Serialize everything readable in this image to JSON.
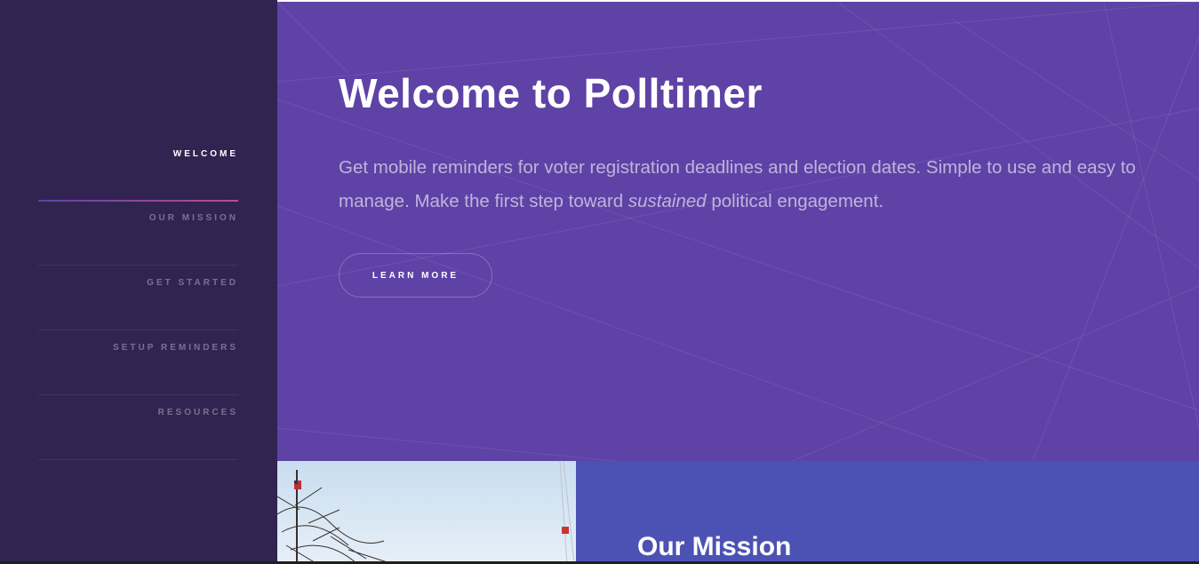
{
  "sidebar": {
    "items": [
      {
        "label": "WELCOME",
        "active": true
      },
      {
        "label": "OUR MISSION",
        "active": false
      },
      {
        "label": "GET STARTED",
        "active": false
      },
      {
        "label": "SETUP REMINDERS",
        "active": false
      },
      {
        "label": "RESOURCES",
        "active": false
      }
    ]
  },
  "hero": {
    "title": "Welcome to Polltimer",
    "text_before": "Get mobile reminders for voter registration deadlines and election dates. Simple to use and easy to manage. Make the first step toward ",
    "text_emphasis": "sustained",
    "text_after": " political engagement.",
    "button_label": "LEARN MORE"
  },
  "mission": {
    "title": "Our Mission"
  },
  "colors": {
    "sidebar": "#312450",
    "hero": "#5e42a6",
    "mission": "#4c52b4",
    "accent_gradient_start": "#5e42a6",
    "accent_gradient_end": "#b74e91"
  }
}
